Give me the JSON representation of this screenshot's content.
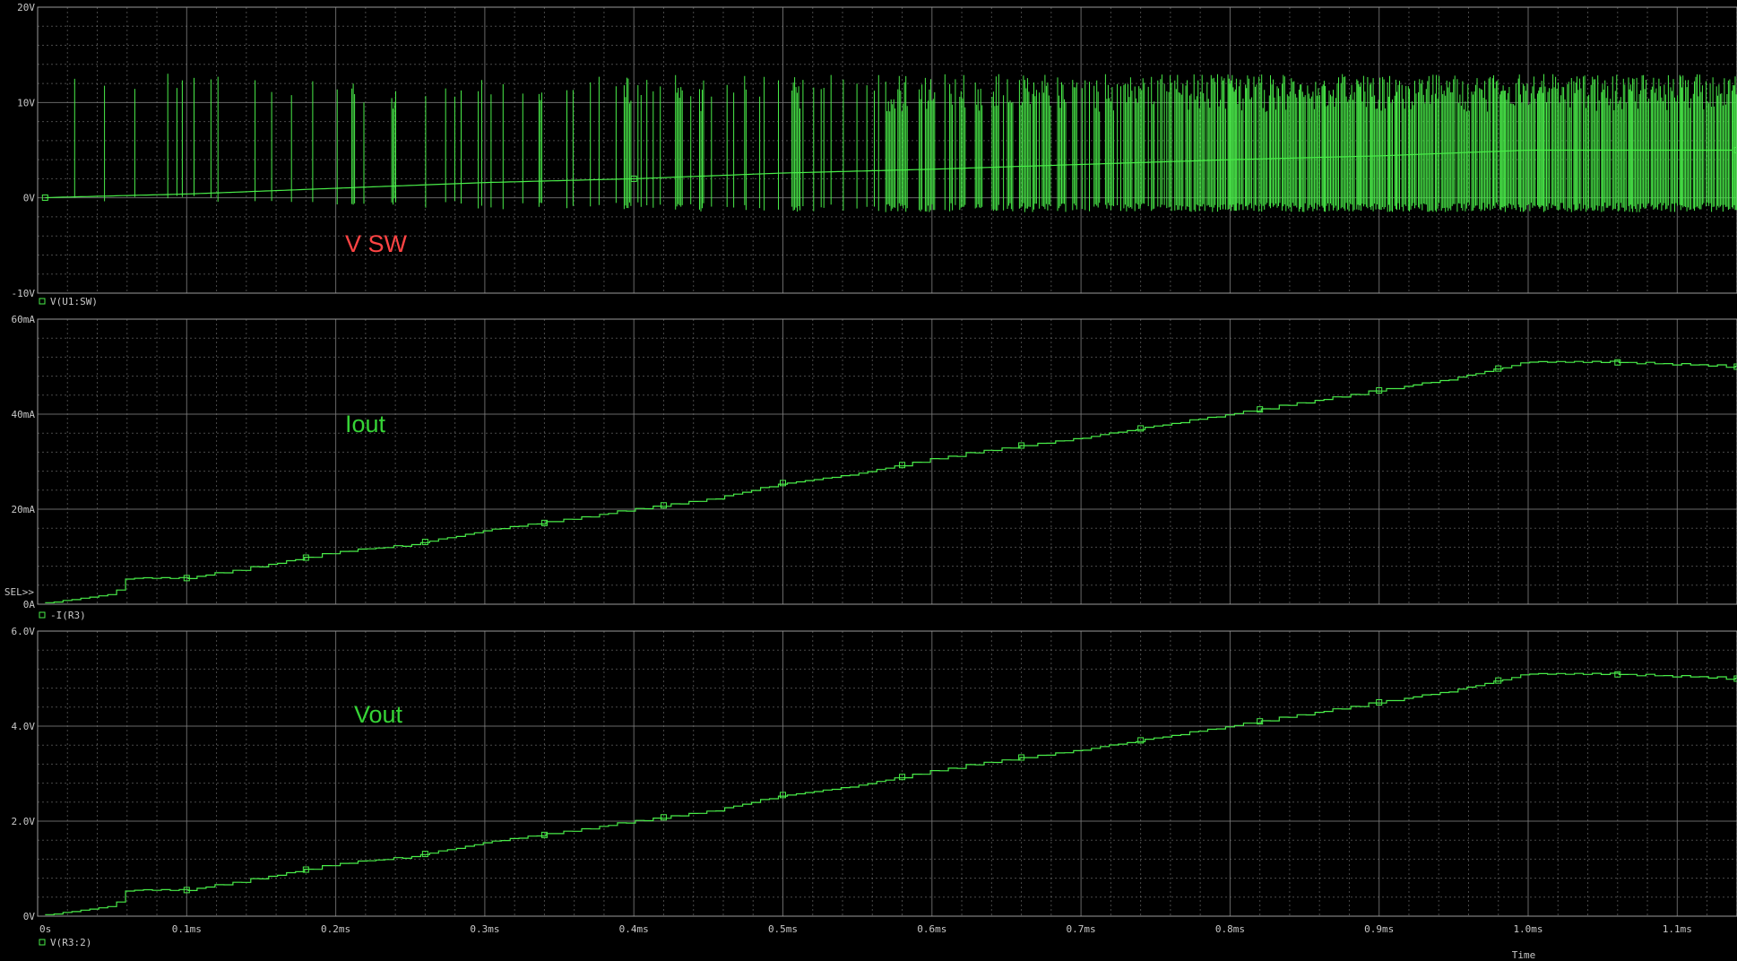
{
  "chart_data": [
    {
      "type": "line",
      "trace_name": "V(U1:SW)",
      "annotation": "V SW",
      "ylim": [
        -10,
        20
      ],
      "y_ticks": [
        "20V",
        "10V",
        "0V",
        "-10V"
      ],
      "series": [
        {
          "name": "V(U1:SW)",
          "envelope_x_ms": [
            0.0,
            0.05,
            0.1,
            0.15,
            0.2,
            0.25,
            0.3,
            0.35,
            0.4,
            0.45,
            0.5,
            0.55,
            0.6,
            0.65,
            0.7,
            0.75,
            0.8,
            0.85,
            0.9,
            0.95,
            1.0,
            1.05,
            1.1,
            1.14
          ],
          "envelope_max_V": [
            13,
            13.5,
            13.5,
            13.5,
            12,
            12,
            13,
            13,
            13,
            13,
            13,
            13,
            13,
            13,
            13,
            13,
            13,
            13,
            13,
            13,
            13,
            13,
            13,
            13
          ],
          "envelope_min_V": [
            -0.5,
            -0.5,
            -0.5,
            -1,
            -1,
            -1,
            -1.2,
            -1.2,
            -1.2,
            -1.5,
            -1.5,
            -1.5,
            -1.5,
            -1.5,
            -1.5,
            -1.5,
            -1.5,
            -1.5,
            -1.5,
            -1.5,
            -1.5,
            -1.5,
            -1.5,
            -1.5
          ],
          "mean_x_ms": [
            0.0,
            0.1,
            0.2,
            0.3,
            0.4,
            0.5,
            0.6,
            0.7,
            0.8,
            0.9,
            1.0,
            1.1,
            1.14
          ],
          "mean_V": [
            0,
            0.4,
            1,
            1.6,
            2,
            2.6,
            3,
            3.5,
            4,
            4.4,
            5,
            5,
            5
          ]
        }
      ]
    },
    {
      "type": "line",
      "trace_name": "-I(R3)",
      "annotation": "Iout",
      "ylim": [
        0,
        60
      ],
      "y_ticks": [
        "60mA",
        "40mA",
        "20mA",
        "0A"
      ],
      "series": [
        {
          "name": "-I(R3)",
          "x_ms": [
            0.0,
            0.01,
            0.05,
            0.06,
            0.1,
            0.15,
            0.2,
            0.25,
            0.3,
            0.35,
            0.4,
            0.45,
            0.5,
            0.55,
            0.6,
            0.65,
            0.7,
            0.75,
            0.8,
            0.85,
            0.9,
            0.95,
            1.0,
            1.05,
            1.1,
            1.14
          ],
          "y_mA": [
            0,
            0.5,
            2,
            5.5,
            5.5,
            8,
            11,
            12.5,
            15.5,
            17.5,
            20,
            22,
            25.5,
            27.5,
            30.5,
            33,
            35,
            37.5,
            40,
            42.5,
            45,
            47.5,
            51,
            51,
            50.5,
            50
          ]
        }
      ]
    },
    {
      "type": "line",
      "trace_name": "V(R3:2)",
      "annotation": "Vout",
      "ylim": [
        0,
        6
      ],
      "y_ticks": [
        "6.0V",
        "4.0V",
        "2.0V",
        "0V"
      ],
      "series": [
        {
          "name": "V(R3:2)",
          "x_ms": [
            0.0,
            0.01,
            0.05,
            0.06,
            0.1,
            0.15,
            0.2,
            0.25,
            0.3,
            0.35,
            0.4,
            0.45,
            0.5,
            0.55,
            0.6,
            0.65,
            0.7,
            0.75,
            0.8,
            0.85,
            0.9,
            0.95,
            1.0,
            1.05,
            1.1,
            1.14
          ],
          "y_V": [
            0,
            0.05,
            0.2,
            0.55,
            0.55,
            0.8,
            1.1,
            1.25,
            1.55,
            1.75,
            2.0,
            2.2,
            2.55,
            2.75,
            3.05,
            3.3,
            3.5,
            3.75,
            4.0,
            4.25,
            4.5,
            4.75,
            5.1,
            5.1,
            5.05,
            5.0
          ]
        }
      ]
    }
  ],
  "x_axis": {
    "xlabel": "Time",
    "xlim_ms": [
      0,
      1.14
    ],
    "tick_values_ms": [
      0,
      0.1,
      0.2,
      0.3,
      0.4,
      0.5,
      0.6,
      0.7,
      0.8,
      0.9,
      1.0,
      1.1
    ],
    "tick_labels": [
      "0s",
      "0.1ms",
      "0.2ms",
      "0.3ms",
      "0.4ms",
      "0.5ms",
      "0.6ms",
      "0.7ms",
      "0.8ms",
      "0.9ms",
      "1.0ms",
      "1.1ms"
    ]
  },
  "sel_marker": "SEL>>",
  "grid": true,
  "colors": {
    "background": "#000000",
    "grid": "#7a7a7a",
    "trace": "#49ec49",
    "text": "#c8c8c8",
    "annotation_vsw": "#ff4444",
    "annotation_other": "#36d436"
  }
}
